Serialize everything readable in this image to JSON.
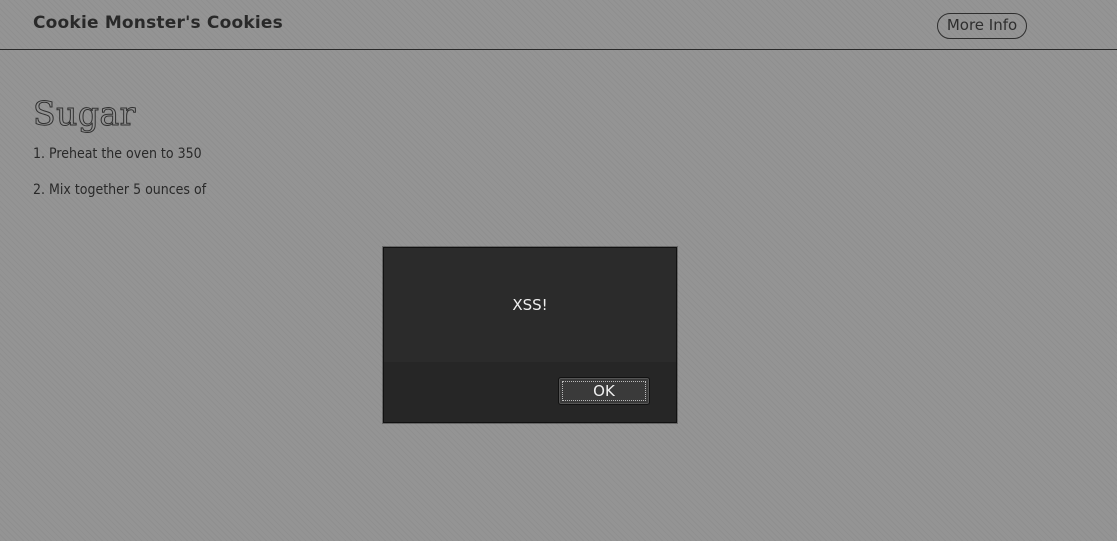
{
  "navbar": {
    "brand": "Cookie Monster's Cookies",
    "more_info_label": "More Info"
  },
  "recipe": {
    "title": "Sugar",
    "steps": [
      "1. Preheat the oven to 350",
      "2. Mix together 5 ounces of"
    ]
  },
  "alert": {
    "message": "XSS!",
    "ok_label": "OK"
  }
}
